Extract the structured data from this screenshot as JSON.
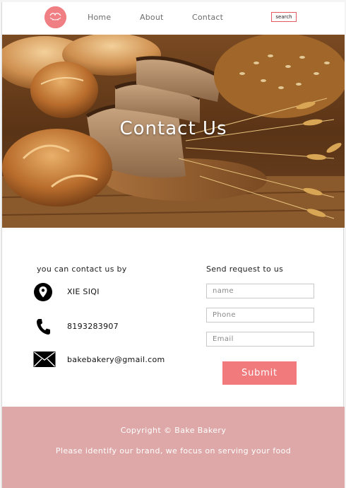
{
  "header": {
    "logo_icon": "bakery-logo-icon",
    "nav": {
      "home": "Home",
      "about": "About",
      "contact": "Contact"
    },
    "search_label": "search"
  },
  "hero": {
    "title": "Contact Us",
    "image": "bread-and-wheat-photo"
  },
  "contact": {
    "heading": "you can contact us by",
    "items": [
      {
        "icon": "location-pin-icon",
        "text": "XIE SIQI"
      },
      {
        "icon": "phone-icon",
        "text": "8193283907"
      },
      {
        "icon": "envelope-icon",
        "text": "bakebakery@gmail.com"
      }
    ]
  },
  "form": {
    "heading": "Send request to us",
    "name_placeholder": "name",
    "phone_placeholder": "Phone",
    "email_placeholder": "Email",
    "submit_label": "Submit"
  },
  "footer": {
    "copyright": "Copyright © Bake Bakery",
    "tagline": "Please identify our brand, we focus on serving your food"
  },
  "colors": {
    "accent": "#f07a7c",
    "footer_bg": "#dea8a8",
    "search_border": "#e45a63"
  }
}
